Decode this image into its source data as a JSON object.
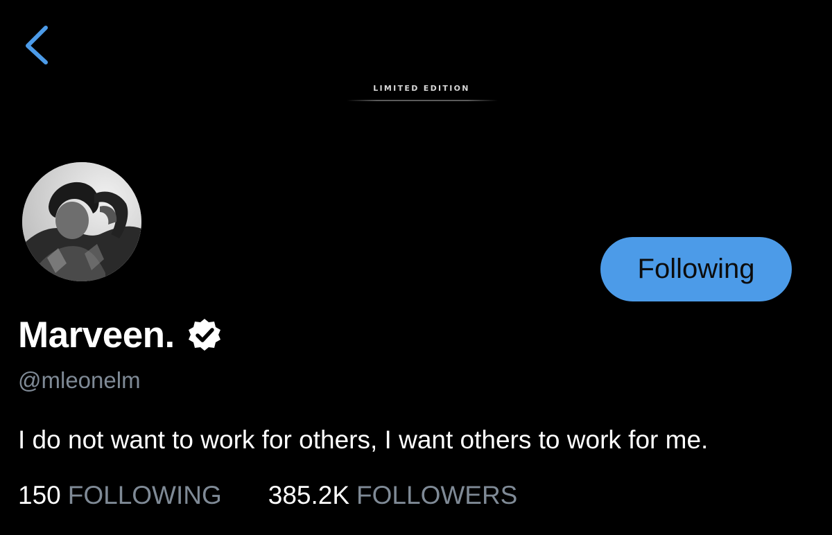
{
  "header": {
    "back_icon": "chevron-left-icon",
    "accent_color": "#4c9be8"
  },
  "banner": {
    "text": "LIMITED EDITION"
  },
  "profile": {
    "display_name": "Marveen.",
    "verified_icon": "verified-badge-icon",
    "handle": "@mleonelm",
    "bio": "I do not want to work for others, I want others to work for me.",
    "follow_button_label": "Following",
    "stats": {
      "following_count": "150",
      "following_label": "FOLLOWING",
      "followers_count": "385.2K",
      "followers_label": "FOLLOWERS"
    }
  }
}
